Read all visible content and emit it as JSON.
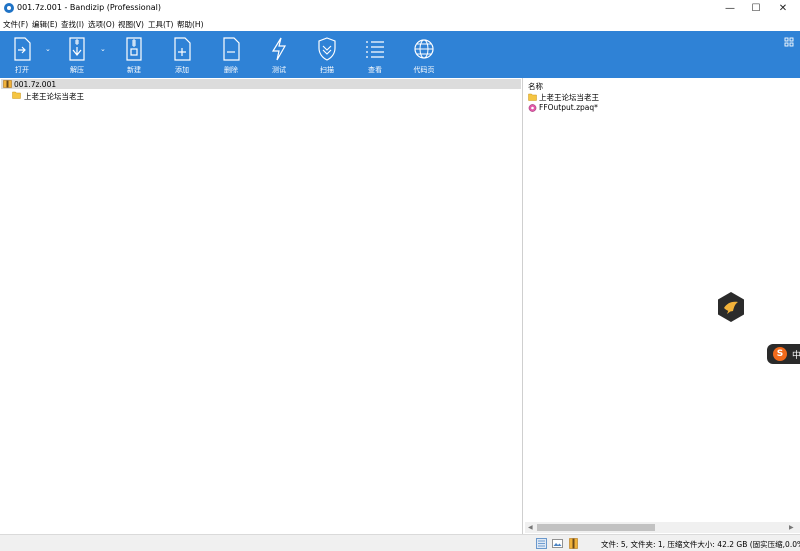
{
  "window": {
    "title": "001.7z.001 - Bandizip (Professional)",
    "controls": {
      "minimize": "—",
      "maximize": "☐",
      "close": "✕"
    }
  },
  "menu": [
    "文件(F)",
    "编辑(E)",
    "查找(I)",
    "选项(O)",
    "视图(V)",
    "工具(T)",
    "帮助(H)"
  ],
  "toolbar": {
    "open": "打开",
    "extract": "解压",
    "new": "新建",
    "add": "添加",
    "delete": "删除",
    "test": "测试",
    "scan": "扫描",
    "view": "查看",
    "codepage": "代码页"
  },
  "tree": {
    "root": "001.7z.001",
    "children": [
      "上老王论坛当老王"
    ]
  },
  "list": {
    "column_name": "名称",
    "items": [
      {
        "name": "上老王论坛当老王",
        "icon": "folder-icon"
      },
      {
        "name": "FFOutput.zpaq*",
        "icon": "archive-icon"
      }
    ]
  },
  "floating": {
    "tab_letter": "S",
    "tab_text": "中"
  },
  "status": {
    "text": "文件: 5, 文件夹: 1, 压缩文件大小: 42.2 GB (固实压缩,0.0%)"
  },
  "colors": {
    "toolbar": "#2f82d6",
    "accent": "#1f73c6"
  }
}
